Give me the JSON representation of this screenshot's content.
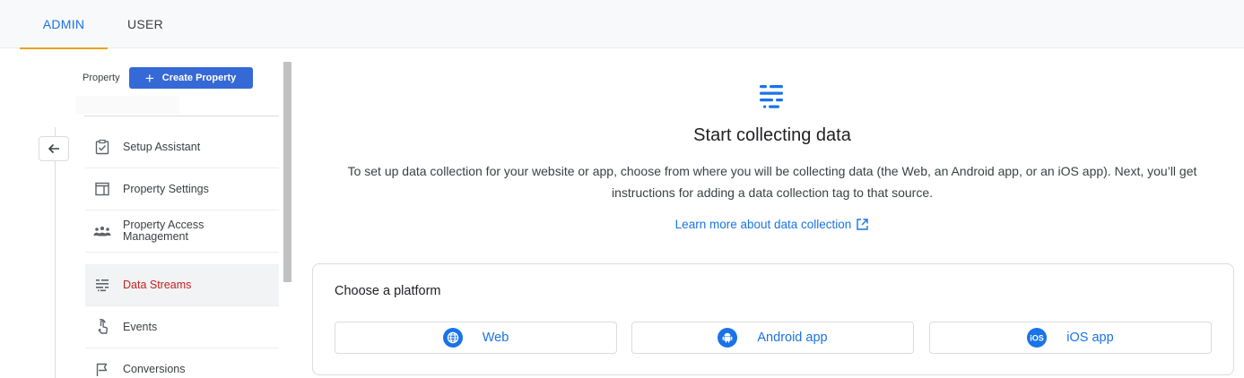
{
  "top_tabs": [
    {
      "label": "ADMIN",
      "active": true
    },
    {
      "label": "USER",
      "active": false
    }
  ],
  "sidebar": {
    "property_label": "Property",
    "create_property_label": "Create Property",
    "items": [
      {
        "label": "Setup Assistant",
        "icon": "clipboard-check-icon"
      },
      {
        "label": "Property Settings",
        "icon": "window-icon"
      },
      {
        "label": "Property Access Management",
        "icon": "people-icon"
      },
      {
        "label": "Data Streams",
        "icon": "data-streams-icon",
        "active": true
      },
      {
        "label": "Events",
        "icon": "touch-icon"
      },
      {
        "label": "Conversions",
        "icon": "flag-icon"
      }
    ]
  },
  "main": {
    "title": "Start collecting data",
    "description": "To set up data collection for your website or app, choose from where you will be collecting data (the Web, an Android app, or an iOS app). Next, you’ll get instructions for adding a data collection tag to that source.",
    "learn_more": "Learn more about data collection",
    "choose_platform": "Choose a platform",
    "platforms": [
      {
        "label": "Web",
        "icon": "globe-icon"
      },
      {
        "label": "Android app",
        "icon": "android-icon"
      },
      {
        "label": "iOS app",
        "icon": "ios-icon",
        "icon_text": "iOS"
      }
    ]
  },
  "colors": {
    "accent_blue": "#1a73e8",
    "create_button": "#3569d6",
    "active_tab_underline": "#e8a317",
    "active_nav_text": "#c5221f"
  }
}
